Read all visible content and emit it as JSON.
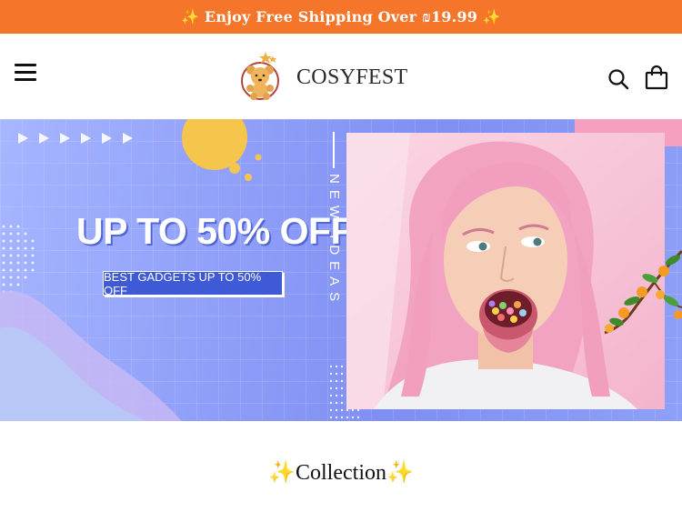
{
  "announcement": {
    "text": "✨ Enjoy Free Shipping Over ₪19.99 ✨"
  },
  "header": {
    "brand": "COSYFEST"
  },
  "banner": {
    "headline": "UP TO 50% OFF",
    "subline": "BEST GADGETS UP TO 50% OFF",
    "vertical_text": "NEW IDEAS"
  },
  "section": {
    "title": "✨Collection✨"
  },
  "icons": [
    "menu-icon",
    "logo-bear-icon",
    "search-icon",
    "cart-icon"
  ],
  "colors": {
    "announcement_bg": "#f5762b",
    "banner_purple": "#8f9ef8",
    "banner_pink": "#f5a0c0",
    "accent_yellow": "#f6c64c"
  }
}
